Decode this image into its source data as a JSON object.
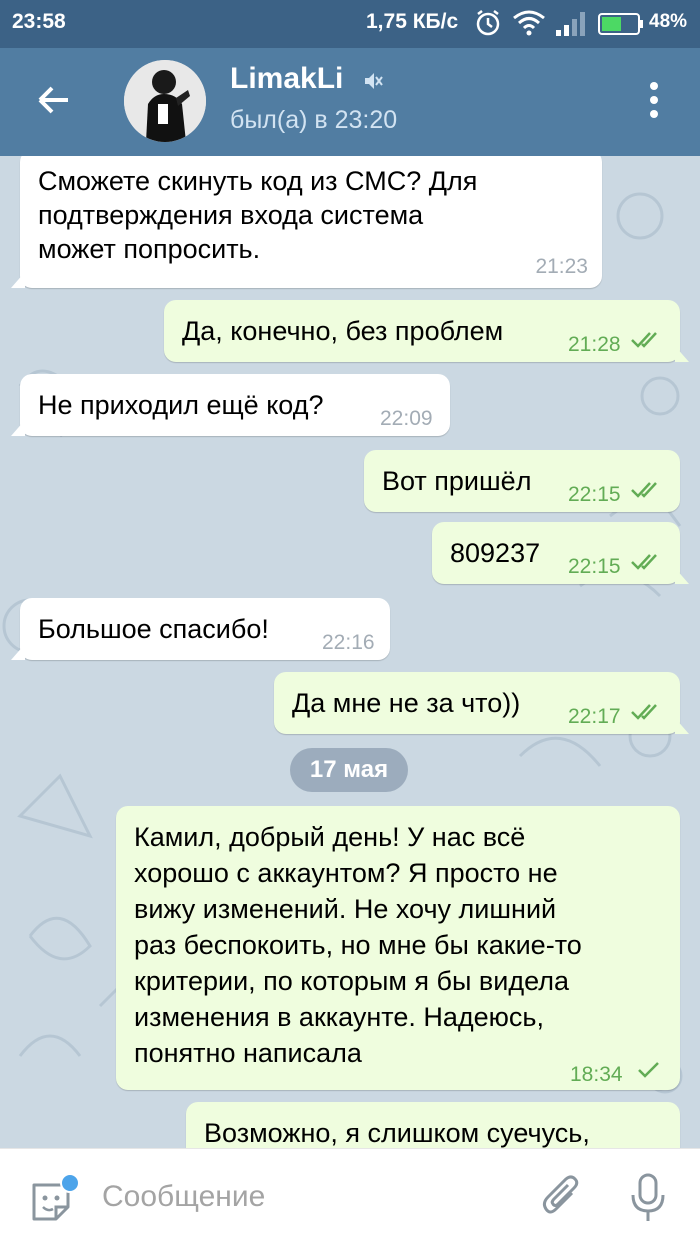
{
  "status_bar": {
    "time": "23:58",
    "speed": "1,75 КБ/с",
    "battery": "48%",
    "icons": [
      "alarm-icon",
      "wifi-icon",
      "signal-icon",
      "battery-icon"
    ]
  },
  "header": {
    "name": "LimakLi",
    "last_seen": "был(а) в 23:20",
    "icons": [
      "back-arrow-icon",
      "muted-icon",
      "more-vert-icon"
    ]
  },
  "date_separator": "17 мая",
  "messages": [
    {
      "direction": "in",
      "lines": [
        "Сможете скинуть код из СМС? Для",
        "подтверждения входа система",
        "может попросить."
      ],
      "time": "21:23"
    },
    {
      "direction": "out",
      "lines": [
        "Да, конечно, без проблем"
      ],
      "time": "21:28",
      "status": "read"
    },
    {
      "direction": "in",
      "lines": [
        "Не приходил ещё код?"
      ],
      "time": "22:09"
    },
    {
      "direction": "out",
      "lines": [
        "Вот пришёл"
      ],
      "time": "22:15",
      "status": "read"
    },
    {
      "direction": "out",
      "lines": [
        "809237"
      ],
      "time": "22:15",
      "status": "read"
    },
    {
      "direction": "in",
      "lines": [
        "Большое спасибо!"
      ],
      "time": "22:16"
    },
    {
      "direction": "out",
      "lines": [
        "Да мне не за что))"
      ],
      "time": "22:17",
      "status": "read"
    },
    {
      "direction": "out",
      "lines": [
        "Камил, добрый день! У нас всё",
        "хорошо с аккаунтом? Я просто не",
        "вижу изменений. Не хочу лишний",
        "раз беспокоить, но мне бы какие-то",
        "критерии, по которым я бы видела",
        "изменения в аккаунте. Надеюсь,",
        "понятно написала"
      ],
      "time": "18:34",
      "status": "sent"
    },
    {
      "direction": "out",
      "lines": [
        "Возможно, я слишком суечусь,"
      ],
      "time": ""
    }
  ],
  "input": {
    "placeholder": "Сообщение"
  },
  "colors": {
    "header": "#517da2",
    "status_bar": "#3c6286",
    "chat_bg": "#cbd8e2",
    "outgoing_bubble": "#effdde",
    "incoming_bubble": "#ffffff",
    "read_check": "#62ac55"
  }
}
